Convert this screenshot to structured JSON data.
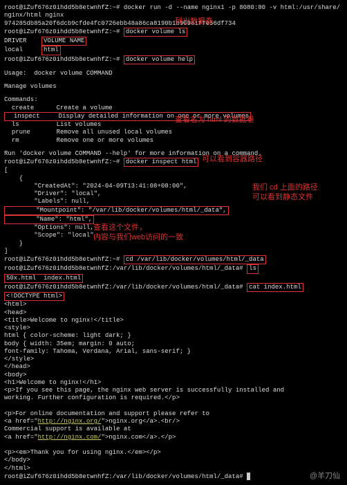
{
  "prompts": {
    "p1": "root@iZuf676z0ihdd5b8etwnhfZ:~# ",
    "p2": "root@iZuf676z0ihdd5b8etwnhfZ:/var/lib/docker/volumes/html/_data# "
  },
  "cmds": {
    "docker_run": "docker run -d --name nginx1 -p 8080:80 -v html:/usr/share/nginx/html nginx",
    "run_output": "974285db85a20f6dcb9cfde4fc0726ebb48a86ca8190b1b9096iffe56df734",
    "vol_ls": "docker volume ls",
    "vol_help": "docker volume help",
    "inspect": "docker inspect html",
    "cd": "cd /var/lib/docker/volumes/html/_data",
    "ls": "ls",
    "cat": "cat index.html"
  },
  "vol_ls_out": {
    "h1": "DRIVER",
    "h2": "VOLUME NAME",
    "r1": "local",
    "r2": "html"
  },
  "help": {
    "usage": "Usage:  docker volume COMMAND",
    "manage": "Manage volumes",
    "commands_label": "Commands:",
    "create": "  create      Create a volume",
    "inspect": "  inspect     Display detailed information on one or more volumes",
    "ls": "  ls          List volumes",
    "prune": "  prune       Remove all unused local volumes",
    "rm": "  rm          Remove one or more volumes",
    "footer": "Run 'docker volume COMMAND --help' for more information on a command."
  },
  "inspect_out": {
    "open": "[",
    "brace_o": "    {",
    "created": "        \"CreatedAt\": \"2024-04-09T13:41:08+08:00\",",
    "driver": "        \"Driver\": \"local\",",
    "labels": "        \"Labels\": null,",
    "mount": "        \"Mountpoint\": \"/var/lib/docker/volumes/html/_data\",",
    "name": "        \"Name\": \"html\",",
    "options": "        \"Options\": null,",
    "scope": "        \"Scope\": \"local\"",
    "brace_c": "    }",
    "close": "]"
  },
  "ls_out": {
    "f1": "50x.html",
    "f2": "index.html"
  },
  "cat_out": {
    "l1": "<!DOCTYPE html>",
    "l2": "<html>",
    "l3": "<head>",
    "l4": "<title>Welcome to nginx!</title>",
    "l5": "<style>",
    "l6": "html { color-scheme: light dark; }",
    "l7": "body { width: 35em; margin: 0 auto;",
    "l8": "font-family: Tahoma, Verdana, Arial, sans-serif; }",
    "l9": "</style>",
    "l10": "</head>",
    "l11": "<body>",
    "l12": "<h1>Welcome to nginx!</h1>",
    "l13": "<p>If you see this page, the nginx web server is successfully installed and",
    "l14": "working. Further configuration is required.</p>",
    "l15": "<p>For online documentation and support please refer to",
    "l16a": "<a href=\"",
    "l16b": "http://nginx.org/",
    "l16c": "\">nginx.org</a>.<br/>",
    "l17": "Commercial support is available at",
    "l18a": "<a href=\"",
    "l18b": "http://nginx.com/",
    "l18c": "\">nginx.com</a>.</p>",
    "l19": "<p><em>Thank you for using nginx.</em></p>",
    "l20": "</body>",
    "l21": "</html>"
  },
  "ann": {
    "a1": "列出数据卷",
    "a2": "查看名为 html 的数据卷",
    "a3": "可以看到容器路径",
    "a4": "我们 cd 上面的路径\n可以看到静态文件",
    "a5": "查看这个文件，\n内容与我们web访问的一致"
  },
  "watermark": "羊刀仙"
}
